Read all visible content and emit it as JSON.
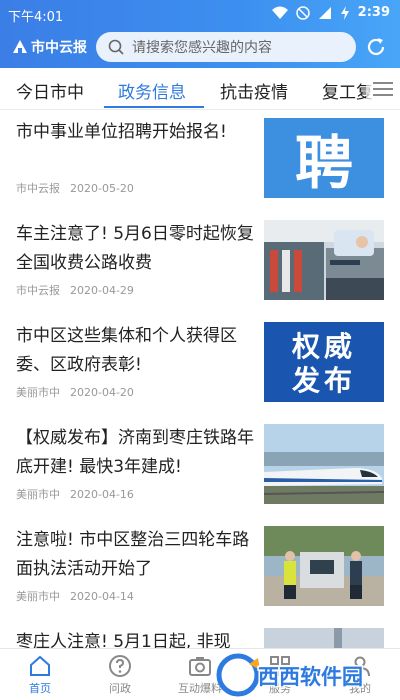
{
  "status": {
    "time": "下午4:01",
    "battery": "2:39"
  },
  "header": {
    "logo": "市中云报",
    "search_placeholder": "请搜索您感兴趣的内容"
  },
  "tabs": [
    {
      "label": "今日市中",
      "active": false
    },
    {
      "label": "政务信息",
      "active": true
    },
    {
      "label": "抗击疫情",
      "active": false
    },
    {
      "label": "复工复",
      "active": false
    }
  ],
  "articles": [
    {
      "title": "市中事业单位招聘开始报名!",
      "source": "市中云报",
      "date": "2020-05-20",
      "thumb_text": "聘"
    },
    {
      "title": "车主注意了! 5月6日零时起恢复全国收费公路收费",
      "source": "市中云报",
      "date": "2020-04-29"
    },
    {
      "title": "市中区这些集体和个人获得区委、区政府表彰!",
      "source": "美丽市中",
      "date": "2020-04-20",
      "thumb_line1": "权威",
      "thumb_line2": "发布"
    },
    {
      "title": "【权威发布】济南到枣庄铁路年底开建! 最快3年建成!",
      "source": "美丽市中",
      "date": "2020-04-16"
    },
    {
      "title": "注意啦! 市中区整治三四轮车路面执法活动开始了",
      "source": "美丽市中",
      "date": "2020-04-14"
    },
    {
      "title": "枣庄人注意! 5月1日起, 非现",
      "source": "",
      "date": ""
    }
  ],
  "bottom_nav": [
    {
      "label": "首页",
      "icon": "home-icon",
      "active": true
    },
    {
      "label": "问政",
      "icon": "question-icon",
      "active": false
    },
    {
      "label": "互动爆料",
      "icon": "camera-icon",
      "active": false
    },
    {
      "label": "服务",
      "icon": "grid-icon",
      "active": false
    },
    {
      "label": "我的",
      "icon": "user-icon",
      "active": false
    }
  ],
  "watermark": {
    "text": "西西软件园"
  },
  "colors": {
    "brand": "#3c8ff0",
    "active_tab": "#2d7be0",
    "meta": "#999999"
  }
}
